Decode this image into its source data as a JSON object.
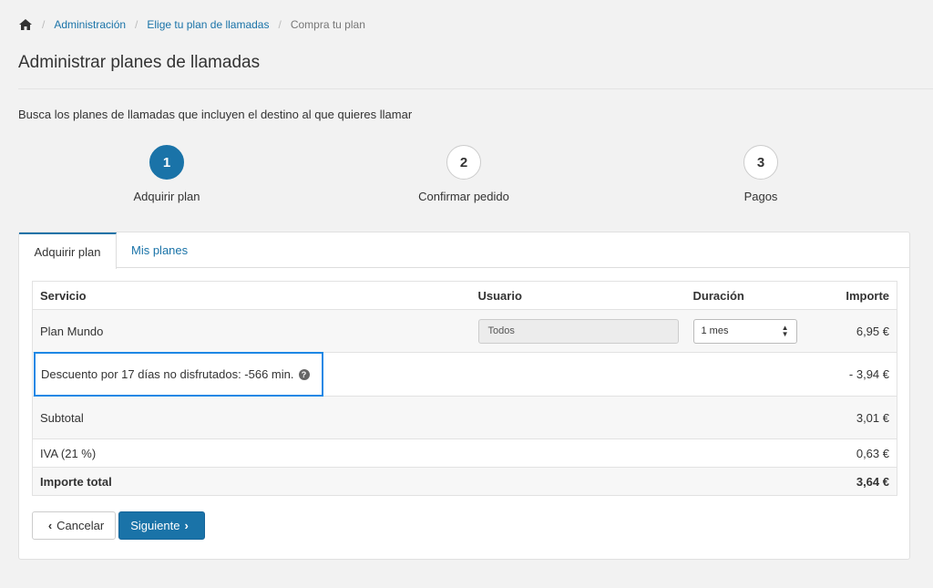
{
  "breadcrumb": {
    "home_icon": "home-icon",
    "items": [
      "Administración",
      "Elige tu plan de llamadas",
      "Compra tu plan"
    ]
  },
  "page": {
    "title": "Administrar planes de llamadas",
    "intro": "Busca los planes de llamadas que incluyen el destino al que quieres llamar"
  },
  "steps": [
    {
      "number": "1",
      "label": "Adquirir plan",
      "active": true
    },
    {
      "number": "2",
      "label": "Confirmar pedido",
      "active": false
    },
    {
      "number": "3",
      "label": "Pagos",
      "active": false
    }
  ],
  "tabs": [
    {
      "label": "Adquirir plan",
      "active": true
    },
    {
      "label": "Mis planes",
      "active": false
    }
  ],
  "table": {
    "headers": {
      "servicio": "Servicio",
      "usuario": "Usuario",
      "duracion": "Duración",
      "importe": "Importe"
    },
    "plan_row": {
      "servicio": "Plan Mundo",
      "usuario": "Todos",
      "duracion": "1 mes",
      "importe": "6,95 €"
    },
    "discount_row": {
      "label": "Descuento por 17 días no disfrutados: -566 min.",
      "importe": "- 3,94 €"
    },
    "subtotal_row": {
      "label": "Subtotal",
      "importe": "3,01 €"
    },
    "iva_row": {
      "label": "IVA (21 %)",
      "importe": "0,63 €"
    },
    "total_row": {
      "label": "Importe total",
      "importe": "3,64 €"
    }
  },
  "buttons": {
    "cancel": "Cancelar",
    "next": "Siguiente"
  },
  "colors": {
    "accent": "#1a73a8",
    "highlight_border": "#1e88e5"
  }
}
